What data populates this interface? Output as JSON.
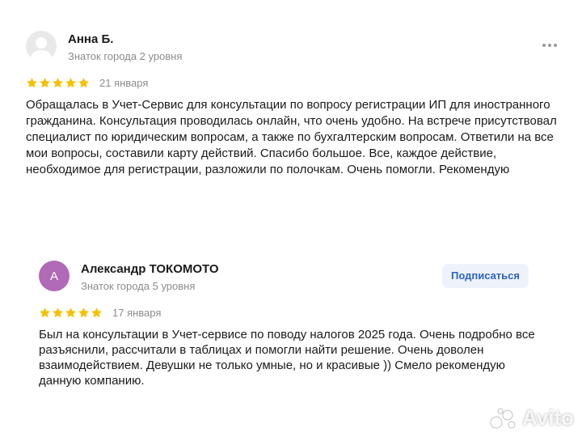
{
  "reviews": [
    {
      "author": "Анна Б.",
      "level": "Знаток города 2 уровня",
      "stars": 5,
      "date": "21 января",
      "text": "Обращалась в Учет-Сервис для консультации по вопросу регистрации ИП для иностранного гражданина. Консультация проводилась онлайн, что очень удобно. На встрече присутствовал специалист по юридическим вопросам, а также по бухгалтерским вопросам. Ответили на все мои вопросы, составили карту действий. Спасибо большое. Все, каждое действие, необходимое для регистрации, разложили по полочкам. Очень помогли. Рекомендую",
      "avatar_icon": "user-silhouette-icon",
      "more_icon": "more-dots-icon"
    },
    {
      "author": "Александр ТОКОМОТО",
      "level": "Знаток города 5 уровня",
      "avatar_letter": "А",
      "subscribe_label": "Подписаться",
      "stars": 5,
      "date": "17 января",
      "text": "Был на консультации в Учет-сервисе по поводу налогов 2025 года. Очень подробно все разъяснили, рассчитали в таблицах и помогли найти решение. Очень доволен взаимодействием. Девушки не только умные, но и красивые )) Смело рекомендую данную компанию."
    }
  ],
  "watermark": "Avito",
  "colors": {
    "star": "#f6c000",
    "avatar_letter_bg": "#b06ab7",
    "subscribe_bg": "#eef3fb",
    "subscribe_text": "#2c63c6",
    "secondary_text": "#8c8c8c"
  }
}
